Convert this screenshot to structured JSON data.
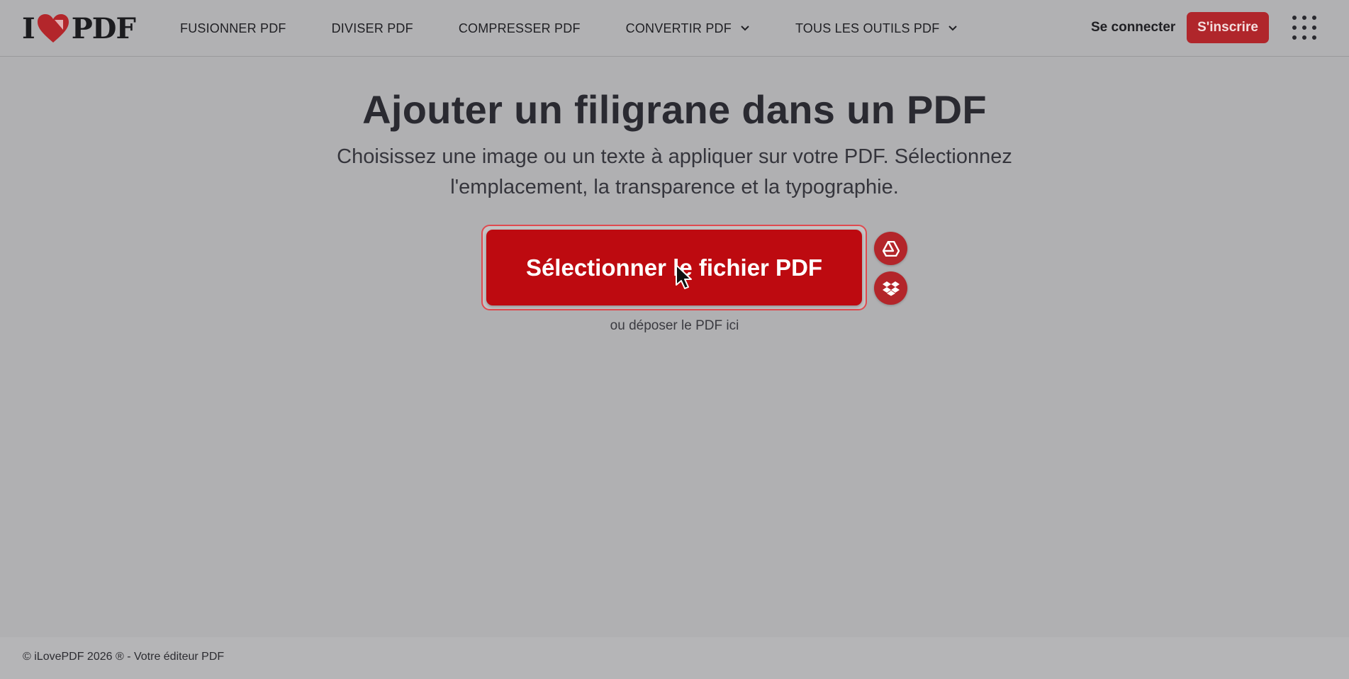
{
  "header": {
    "logo": {
      "left": "I",
      "right": "PDF"
    },
    "nav": [
      {
        "label": "FUSIONNER PDF",
        "dropdown": false
      },
      {
        "label": "DIVISER PDF",
        "dropdown": false
      },
      {
        "label": "COMPRESSER PDF",
        "dropdown": false
      },
      {
        "label": "CONVERTIR PDF",
        "dropdown": true
      },
      {
        "label": "TOUS LES OUTILS PDF",
        "dropdown": true
      }
    ],
    "login_label": "Se connecter",
    "signup_label": "S'inscrire"
  },
  "main": {
    "title": "Ajouter un filigrane dans un PDF",
    "subtitle": "Choisissez une image ou un texte à appliquer sur votre PDF. Sélectionnez l'emplacement, la transparence et la typographie.",
    "select_label": "Sélectionner le fichier PDF",
    "drop_hint": "ou déposer le PDF ici"
  },
  "footer": {
    "text": "© iLovePDF 2026 ® - Votre éditeur PDF"
  },
  "colors": {
    "brand": "#bd0a10",
    "page_bg": "#b0b0b2"
  }
}
